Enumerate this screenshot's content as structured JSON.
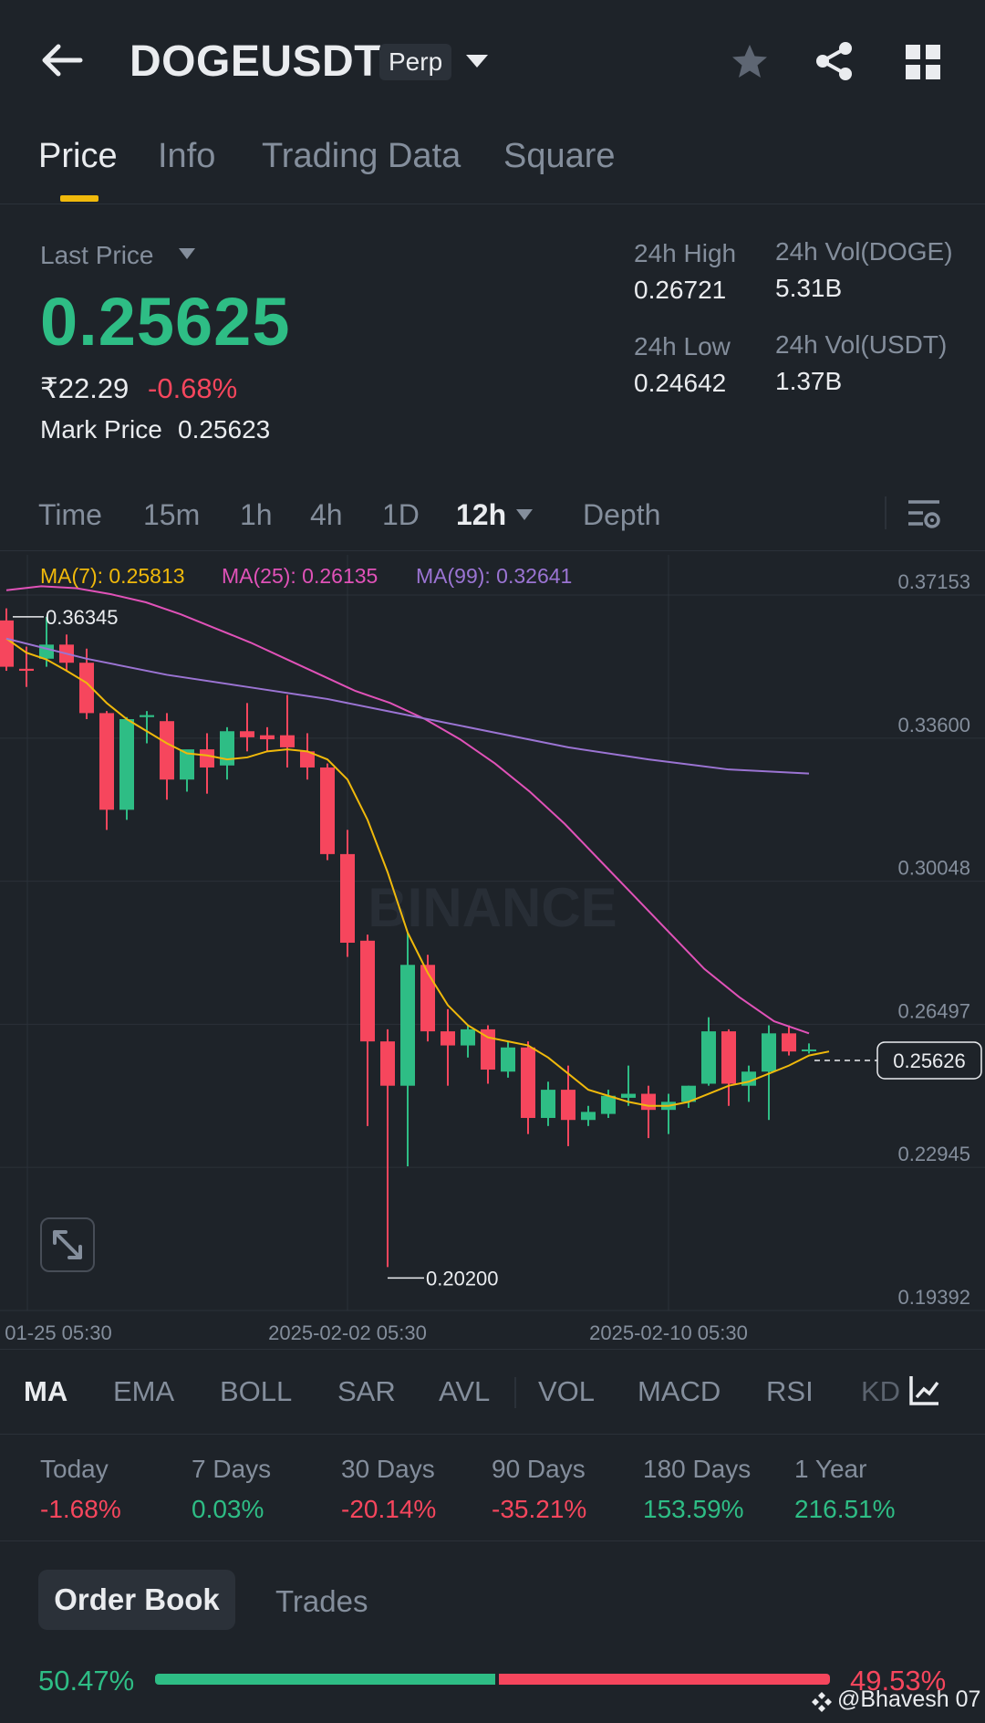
{
  "header": {
    "symbol": "DOGEUSDT",
    "contract_type": "Perp",
    "icons": [
      "back-arrow-icon",
      "dropdown-caret-icon",
      "star-icon",
      "share-icon",
      "grid-icon"
    ]
  },
  "tabs": [
    {
      "label": "Price",
      "active": true
    },
    {
      "label": "Info",
      "active": false
    },
    {
      "label": "Trading Data",
      "active": false
    },
    {
      "label": "Square",
      "active": false
    }
  ],
  "price": {
    "last_price_label": "Last Price",
    "last_price": "0.25625",
    "inr_price": "₹22.29",
    "change_pct": "-0.68%",
    "mark_price_label": "Mark Price",
    "mark_price": "0.25623"
  },
  "stats": {
    "high_label": "24h High",
    "high": "0.26721",
    "low_label": "24h Low",
    "low": "0.24642",
    "vol_doge_label": "24h Vol(DOGE)",
    "vol_doge": "5.31B",
    "vol_usdt_label": "24h Vol(USDT)",
    "vol_usdt": "1.37B"
  },
  "intervals": {
    "items": [
      "Time",
      "15m",
      "1h",
      "4h",
      "1D",
      "12h",
      "Depth"
    ],
    "active": "12h"
  },
  "colors": {
    "up": "#2ebd85",
    "down": "#f6465d",
    "accent": "#f0b90b",
    "ma7": "#f0b90b",
    "ma25": "#e052b8",
    "ma99": "#9b74d3",
    "background": "#1e2329"
  },
  "chart_data": {
    "type": "candlestick",
    "interval": "12h",
    "ylim": [
      0.19392,
      0.37153
    ],
    "y_ticks": [
      "0.37153",
      "0.33600",
      "0.30048",
      "0.26497",
      "0.22945",
      "0.19392"
    ],
    "x_ticks": [
      "01-25 05:30",
      "2025-02-02 05:30",
      "2025-02-10 05:30"
    ],
    "indicators": {
      "ma7": "MA(7): 0.25813",
      "ma25": "MA(25): 0.26135",
      "ma99": "MA(99): 0.32641"
    },
    "annotations": {
      "high_marker": "0.36345",
      "low_marker": "0.20200",
      "current_price_tag": "0.25626"
    },
    "watermark": "BINANCE",
    "candles": [
      {
        "o": 0.3625,
        "h": 0.3655,
        "l": 0.35,
        "c": 0.351
      },
      {
        "o": 0.3505,
        "h": 0.356,
        "l": 0.346,
        "c": 0.35
      },
      {
        "o": 0.353,
        "h": 0.3634,
        "l": 0.351,
        "c": 0.3565
      },
      {
        "o": 0.3565,
        "h": 0.359,
        "l": 0.35,
        "c": 0.352
      },
      {
        "o": 0.352,
        "h": 0.3555,
        "l": 0.338,
        "c": 0.3395
      },
      {
        "o": 0.3395,
        "h": 0.34,
        "l": 0.3105,
        "c": 0.3155
      },
      {
        "o": 0.3155,
        "h": 0.3385,
        "l": 0.313,
        "c": 0.338
      },
      {
        "o": 0.3385,
        "h": 0.34,
        "l": 0.332,
        "c": 0.339
      },
      {
        "o": 0.3375,
        "h": 0.3395,
        "l": 0.318,
        "c": 0.323
      },
      {
        "o": 0.323,
        "h": 0.33,
        "l": 0.32,
        "c": 0.3305
      },
      {
        "o": 0.3305,
        "h": 0.3345,
        "l": 0.3195,
        "c": 0.326
      },
      {
        "o": 0.3265,
        "h": 0.336,
        "l": 0.323,
        "c": 0.335
      },
      {
        "o": 0.335,
        "h": 0.342,
        "l": 0.33,
        "c": 0.3335
      },
      {
        "o": 0.334,
        "h": 0.336,
        "l": 0.33,
        "c": 0.333
      },
      {
        "o": 0.334,
        "h": 0.344,
        "l": 0.326,
        "c": 0.331
      },
      {
        "o": 0.33,
        "h": 0.3345,
        "l": 0.323,
        "c": 0.326
      },
      {
        "o": 0.326,
        "h": 0.327,
        "l": 0.303,
        "c": 0.3045
      },
      {
        "o": 0.3045,
        "h": 0.3105,
        "l": 0.279,
        "c": 0.2825
      },
      {
        "o": 0.283,
        "h": 0.2845,
        "l": 0.237,
        "c": 0.258
      },
      {
        "o": 0.258,
        "h": 0.261,
        "l": 0.202,
        "c": 0.247
      },
      {
        "o": 0.247,
        "h": 0.285,
        "l": 0.227,
        "c": 0.277
      },
      {
        "o": 0.277,
        "h": 0.2795,
        "l": 0.258,
        "c": 0.2605
      },
      {
        "o": 0.2605,
        "h": 0.266,
        "l": 0.247,
        "c": 0.257
      },
      {
        "o": 0.257,
        "h": 0.262,
        "l": 0.254,
        "c": 0.261
      },
      {
        "o": 0.261,
        "h": 0.262,
        "l": 0.2475,
        "c": 0.251
      },
      {
        "o": 0.2505,
        "h": 0.258,
        "l": 0.249,
        "c": 0.2565
      },
      {
        "o": 0.2565,
        "h": 0.258,
        "l": 0.235,
        "c": 0.239
      },
      {
        "o": 0.239,
        "h": 0.248,
        "l": 0.237,
        "c": 0.246
      },
      {
        "o": 0.246,
        "h": 0.252,
        "l": 0.232,
        "c": 0.2385
      },
      {
        "o": 0.2385,
        "h": 0.242,
        "l": 0.237,
        "c": 0.2405
      },
      {
        "o": 0.24,
        "h": 0.246,
        "l": 0.239,
        "c": 0.2445
      },
      {
        "o": 0.244,
        "h": 0.252,
        "l": 0.242,
        "c": 0.245
      },
      {
        "o": 0.245,
        "h": 0.247,
        "l": 0.234,
        "c": 0.241
      },
      {
        "o": 0.241,
        "h": 0.245,
        "l": 0.235,
        "c": 0.243
      },
      {
        "o": 0.243,
        "h": 0.247,
        "l": 0.2415,
        "c": 0.247
      },
      {
        "o": 0.2475,
        "h": 0.264,
        "l": 0.247,
        "c": 0.2605
      },
      {
        "o": 0.2605,
        "h": 0.261,
        "l": 0.242,
        "c": 0.2475
      },
      {
        "o": 0.247,
        "h": 0.252,
        "l": 0.243,
        "c": 0.2505
      },
      {
        "o": 0.2505,
        "h": 0.262,
        "l": 0.2385,
        "c": 0.26
      },
      {
        "o": 0.26,
        "h": 0.262,
        "l": 0.2545,
        "c": 0.2555
      },
      {
        "o": 0.256,
        "h": 0.2575,
        "l": 0.255,
        "c": 0.256
      }
    ],
    "ma7_values": [
      0.358,
      0.3545,
      0.3528,
      0.35,
      0.347,
      0.342,
      0.338,
      0.335,
      0.332,
      0.3295,
      0.329,
      0.328,
      0.3285,
      0.33,
      0.3305,
      0.33,
      0.328,
      0.323,
      0.313,
      0.3,
      0.285,
      0.275,
      0.267,
      0.262,
      0.259,
      0.258,
      0.257,
      0.254,
      0.25,
      0.246,
      0.2445,
      0.243,
      0.242,
      0.242,
      0.243,
      0.245,
      0.247,
      0.248,
      0.25,
      0.252,
      0.2545,
      0.2555
    ],
    "ma25_values": [
      0.37,
      0.371,
      0.3705,
      0.369,
      0.367,
      0.364,
      0.3605,
      0.357,
      0.353,
      0.349,
      0.345,
      0.342,
      0.338,
      0.333,
      0.327,
      0.32,
      0.312,
      0.303,
      0.294,
      0.285,
      0.276,
      0.269,
      0.263,
      0.26
    ],
    "ma99_values": [
      0.358,
      0.353,
      0.349,
      0.346,
      0.343,
      0.339,
      0.335,
      0.331,
      0.328,
      0.3255,
      0.3245
    ]
  },
  "indicators": {
    "items": [
      "MA",
      "EMA",
      "BOLL",
      "SAR",
      "AVL",
      "VOL",
      "MACD",
      "RSI",
      "KD"
    ],
    "active": "MA"
  },
  "performance": [
    {
      "period": "Today",
      "value": "-1.68%",
      "dir": "down"
    },
    {
      "period": "7 Days",
      "value": "0.03%",
      "dir": "up"
    },
    {
      "period": "30 Days",
      "value": "-20.14%",
      "dir": "down"
    },
    {
      "period": "90 Days",
      "value": "-35.21%",
      "dir": "down"
    },
    {
      "period": "180 Days",
      "value": "153.59%",
      "dir": "up"
    },
    {
      "period": "1 Year",
      "value": "216.51%",
      "dir": "up"
    }
  ],
  "order_book": {
    "tab_active": "Order Book",
    "tab_other": "Trades",
    "bid_pct": "50.47%",
    "ask_pct": "49.53%",
    "bid_ratio": 0.5047
  },
  "watermark_text": "@Bhavesh 07"
}
